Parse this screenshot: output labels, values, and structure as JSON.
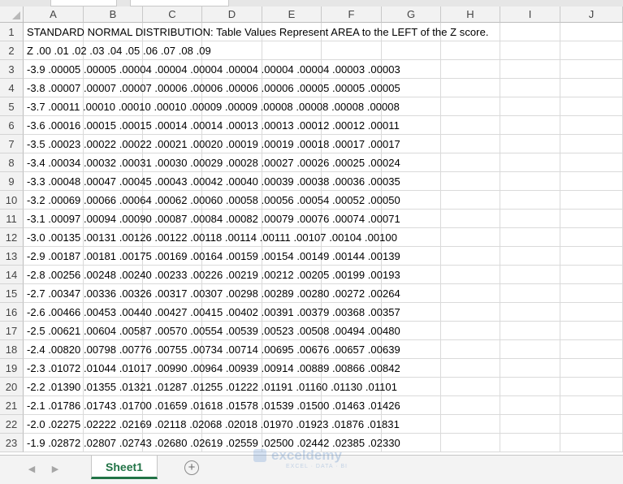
{
  "columns": [
    "A",
    "B",
    "C",
    "D",
    "E",
    "F",
    "G",
    "H",
    "I",
    "J"
  ],
  "rows": [
    {
      "n": "1",
      "text": "STANDARD NORMAL DISTRIBUTION: Table Values Represent AREA to the LEFT of the Z score."
    },
    {
      "n": "2",
      "text": "Z .00 .01 .02 .03 .04 .05 .06 .07 .08 .09"
    },
    {
      "n": "3",
      "text": "-3.9 .00005 .00005 .00004 .00004 .00004 .00004 .00004 .00004 .00003 .00003"
    },
    {
      "n": "4",
      "text": "-3.8 .00007 .00007 .00007 .00006 .00006 .00006 .00006 .00005 .00005 .00005"
    },
    {
      "n": "5",
      "text": "-3.7 .00011 .00010 .00010 .00010 .00009 .00009 .00008 .00008 .00008 .00008"
    },
    {
      "n": "6",
      "text": "-3.6 .00016 .00015 .00015 .00014 .00014 .00013 .00013 .00012 .00012 .00011"
    },
    {
      "n": "7",
      "text": "-3.5 .00023 .00022 .00022 .00021 .00020 .00019 .00019 .00018 .00017 .00017"
    },
    {
      "n": "8",
      "text": "-3.4 .00034 .00032 .00031 .00030 .00029 .00028 .00027 .00026 .00025 .00024"
    },
    {
      "n": "9",
      "text": "-3.3 .00048 .00047 .00045 .00043 .00042 .00040 .00039 .00038 .00036 .00035"
    },
    {
      "n": "10",
      "text": "-3.2 .00069 .00066 .00064 .00062 .00060 .00058 .00056 .00054 .00052 .00050"
    },
    {
      "n": "11",
      "text": "-3.1 .00097 .00094 .00090 .00087 .00084 .00082 .00079 .00076 .00074 .00071"
    },
    {
      "n": "12",
      "text": "-3.0 .00135 .00131 .00126 .00122 .00118 .00114 .00111 .00107 .00104 .00100"
    },
    {
      "n": "13",
      "text": "-2.9 .00187 .00181 .00175 .00169 .00164 .00159 .00154 .00149 .00144 .00139"
    },
    {
      "n": "14",
      "text": "-2.8 .00256 .00248 .00240 .00233 .00226 .00219 .00212 .00205 .00199 .00193"
    },
    {
      "n": "15",
      "text": "-2.7 .00347 .00336 .00326 .00317 .00307 .00298 .00289 .00280 .00272 .00264"
    },
    {
      "n": "16",
      "text": "-2.6 .00466 .00453 .00440 .00427 .00415 .00402 .00391 .00379 .00368 .00357"
    },
    {
      "n": "17",
      "text": "-2.5 .00621 .00604 .00587 .00570 .00554 .00539 .00523 .00508 .00494 .00480"
    },
    {
      "n": "18",
      "text": "-2.4 .00820 .00798 .00776 .00755 .00734 .00714 .00695 .00676 .00657 .00639"
    },
    {
      "n": "19",
      "text": "-2.3 .01072 .01044 .01017 .00990 .00964 .00939 .00914 .00889 .00866 .00842"
    },
    {
      "n": "20",
      "text": "-2.2 .01390 .01355 .01321 .01287 .01255 .01222 .01191 .01160 .01130 .01101"
    },
    {
      "n": "21",
      "text": "-2.1 .01786 .01743 .01700 .01659 .01618 .01578 .01539 .01500 .01463 .01426"
    },
    {
      "n": "22",
      "text": "-2.0 .02275 .02222 .02169 .02118 .02068 .02018 .01970 .01923 .01876 .01831"
    },
    {
      "n": "23",
      "text": "-1.9 .02872 .02807 .02743 .02680 .02619 .02559 .02500 .02442 .02385 .02330"
    }
  ],
  "tabs": {
    "prev_icon": "triangle-left-icon",
    "next_icon": "triangle-right-icon",
    "sheet_label": "Sheet1",
    "add_icon": "plus-circle-icon",
    "add_glyph": "+"
  },
  "watermark": {
    "line1": "exceldemy",
    "line2": "EXCEL · DATA · BI"
  }
}
